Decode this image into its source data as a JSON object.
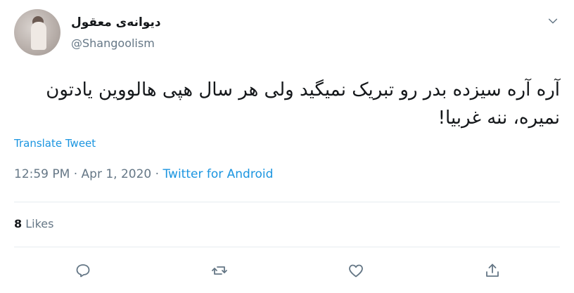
{
  "author": {
    "display_name": "دیوانه‌ی معقول",
    "handle": "@Shangoolism",
    "avatar_icon": "profile-photo"
  },
  "tweet": {
    "text": "آره آره سیزده بدر رو تبریک نمیگید ولی هر سال هپی هالووین یادتون نمیره، ننه غربیا!",
    "translate_label": "Translate Tweet",
    "time": "12:59 PM",
    "separator": "·",
    "date": "Apr 1, 2020",
    "source": "Twitter for Android"
  },
  "stats": {
    "likes_count": "8",
    "likes_label": "Likes"
  },
  "actions": [
    "reply-icon",
    "retweet-icon",
    "like-icon",
    "share-icon"
  ],
  "colors": {
    "link": "#1b95e0",
    "secondary_text": "#657786",
    "primary_text": "#14171a",
    "divider": "#e6ecf0"
  }
}
